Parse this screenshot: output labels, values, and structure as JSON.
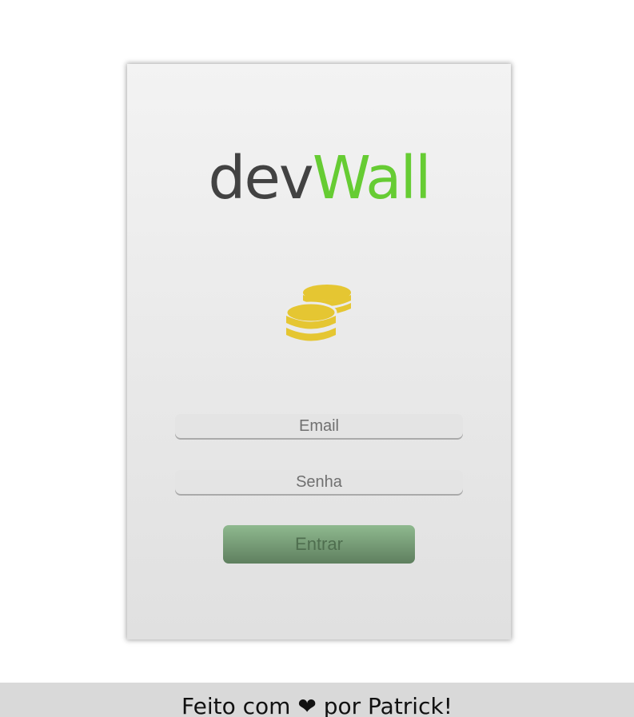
{
  "logo": {
    "part1": "dev",
    "part2": "Wall"
  },
  "colors": {
    "logo_dark": "#424242",
    "logo_green": "#66cc33",
    "coins": "#e5c632",
    "button": "#6f956f"
  },
  "icon": {
    "name": "coins-icon"
  },
  "form": {
    "email_placeholder": "Email",
    "password_placeholder": "Senha",
    "submit_label": "Entrar"
  },
  "footer": {
    "prefix": "Feito com",
    "heart": "❤",
    "suffix": "por Patrick!"
  }
}
